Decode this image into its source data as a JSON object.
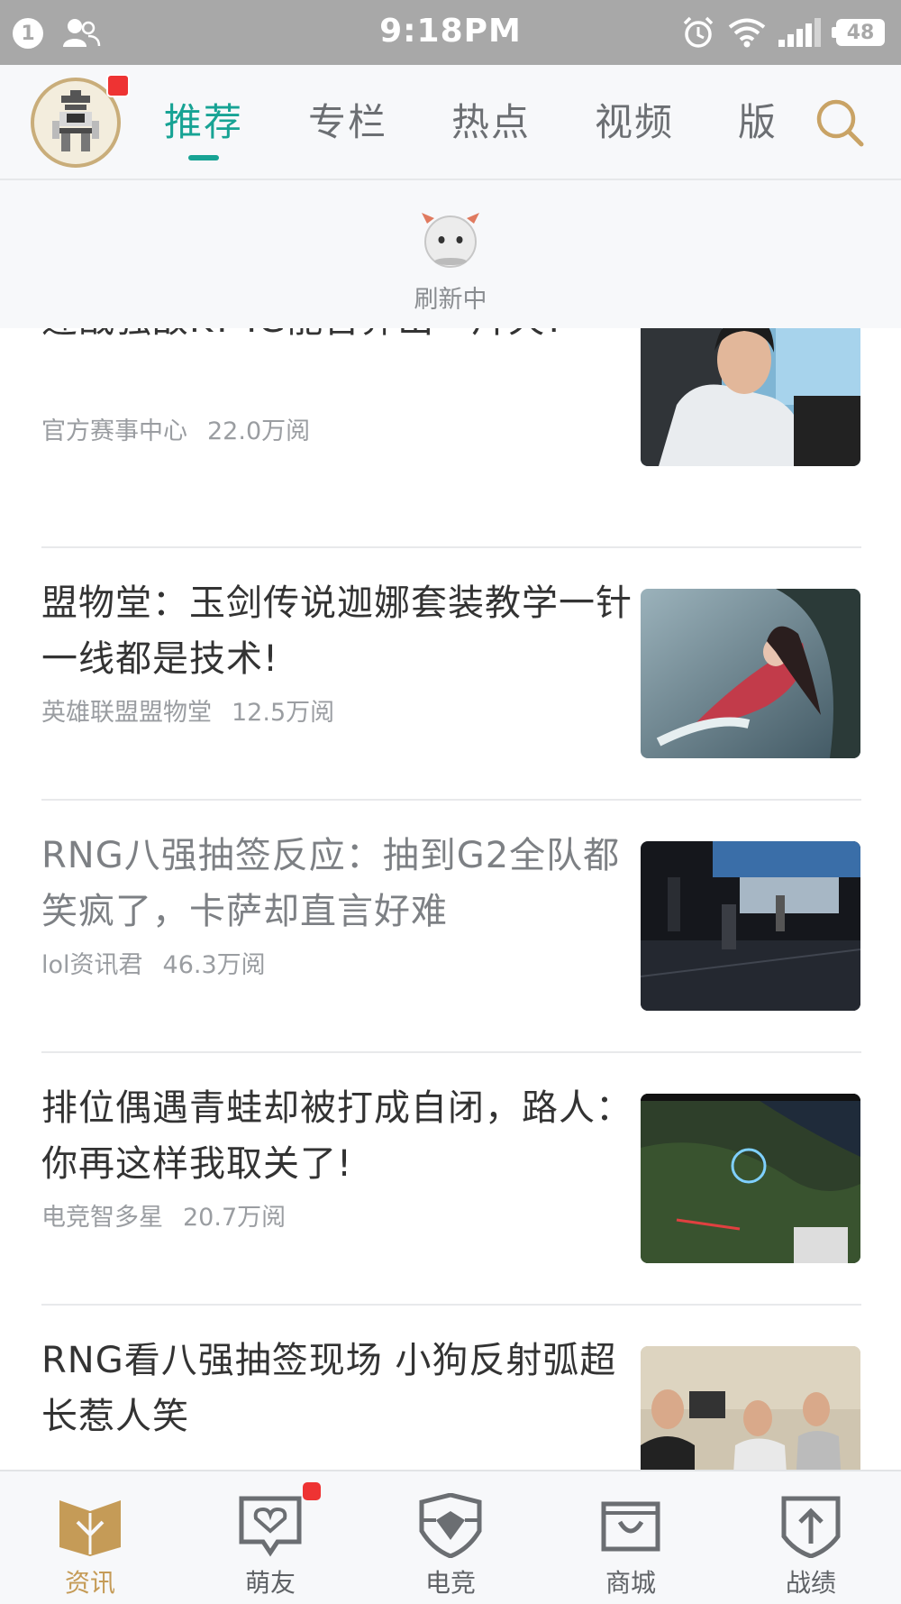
{
  "status_bar": {
    "notification_count": "1",
    "time": "9:18PM",
    "battery": "48"
  },
  "top_nav": {
    "tabs": [
      {
        "label": "推荐",
        "active": true
      },
      {
        "label": "专栏",
        "active": false
      },
      {
        "label": "热点",
        "active": false
      },
      {
        "label": "视频",
        "active": false
      },
      {
        "label": "版",
        "active": false
      }
    ]
  },
  "refresh": {
    "text": "刷新中"
  },
  "feed": {
    "items": [
      {
        "title": "迎战强敌KT IG能否莽出一片天?",
        "source": "官方赛事中心",
        "views": "22.0万阅",
        "read": false
      },
      {
        "title": "盟物堂：玉剑传说迦娜套装教学一针一线都是技术!",
        "source": "英雄联盟盟物堂",
        "views": "12.5万阅",
        "read": false
      },
      {
        "title": "RNG八强抽签反应：抽到G2全队都笑疯了，卡萨却直言好难",
        "source": "lol资讯君",
        "views": "46.3万阅",
        "read": true
      },
      {
        "title": "排位偶遇青蛙却被打成自闭，路人：你再这样我取关了!",
        "source": "电竞智多星",
        "views": "20.7万阅",
        "read": false
      },
      {
        "title": "RNG看八强抽签现场 小狗反射弧超长惹人笑",
        "source": "",
        "views": "",
        "read": false
      }
    ]
  },
  "bottom_bar": {
    "items": [
      {
        "label": "资讯",
        "icon": "news-book-icon",
        "active": true
      },
      {
        "label": "萌友",
        "icon": "friends-heart-icon",
        "active": false
      },
      {
        "label": "电竞",
        "icon": "esports-shield-icon",
        "active": false
      },
      {
        "label": "商城",
        "icon": "shop-bag-icon",
        "active": false
      },
      {
        "label": "战绩",
        "icon": "stats-shield-icon",
        "active": false
      }
    ]
  },
  "colors": {
    "accent": "#17a394",
    "gold": "#c59b57",
    "badge": "#ee3333",
    "status_bar": "#a8a8a8"
  }
}
